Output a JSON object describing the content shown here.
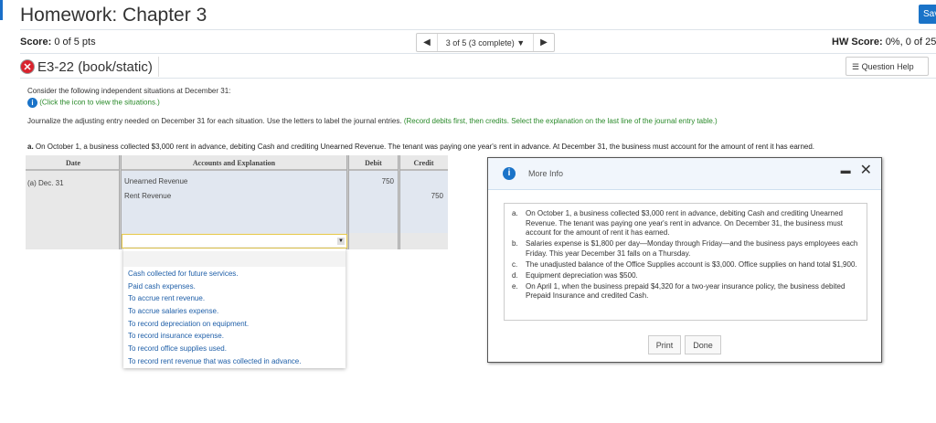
{
  "header": {
    "title": "Homework: Chapter 3",
    "save_label": "Sav"
  },
  "score": {
    "label": "Score:",
    "value": "0 of 5 pts"
  },
  "nav": {
    "prev": "◀",
    "position": "3 of 5 (3 complete) ▼",
    "next": "▶"
  },
  "hw_score": {
    "label": "HW Score:",
    "value": "0%, 0 of 25"
  },
  "question": {
    "id": "E3-22 (book/static)",
    "help_label": "Question Help"
  },
  "instructions": {
    "line1": "Consider the following independent situations at December 31:",
    "link": "(Click the icon to view the situations.)",
    "line3": "Journalize the adjusting entry needed on December 31 for each situation. Use the letters to label the journal entries.",
    "line3_hint": "(Record debits first, then credits. Select the explanation on the last line of the journal entry table.)"
  },
  "situation_a": {
    "letter": "a.",
    "text": "On October 1, a business collected $3,000 rent in advance, debiting Cash and crediting Unearned Revenue. The tenant was paying one year's rent in advance. At December 31, the business must account for the amount of rent it has earned."
  },
  "table": {
    "headers": [
      "Date",
      "Accounts and Explanation",
      "Debit",
      "Credit"
    ],
    "date": "(a) Dec. 31",
    "rows": [
      {
        "account": "Unearned Revenue",
        "debit": "750",
        "credit": ""
      },
      {
        "account": "Rent Revenue",
        "debit": "",
        "credit": "750"
      }
    ]
  },
  "dropdown": {
    "options": [
      "Cash collected for future services.",
      "Paid cash expenses.",
      "To accrue rent revenue.",
      "To accrue salaries expense.",
      "To record depreciation on equipment.",
      "To record insurance expense.",
      "To record office supplies used.",
      "To record rent revenue that was collected in advance."
    ]
  },
  "modal": {
    "title": "More Info",
    "minimize": "▬",
    "close": "✕",
    "items": [
      {
        "l": "a.",
        "t": "On October 1, a business collected $3,000 rent in advance, debiting Cash and crediting Unearned Revenue. The tenant was paying one year's rent in advance. On December 31, the business must account for the amount of rent it has earned."
      },
      {
        "l": "b.",
        "t": "Salaries expense is $1,800 per day—Monday through Friday—and the business pays employees each Friday. This year December 31 falls on a Thursday."
      },
      {
        "l": "c.",
        "t": "The unadjusted balance of the Office Supplies account is $3,000. Office supplies on hand total $1,900."
      },
      {
        "l": "d.",
        "t": "Equipment depreciation was $500."
      },
      {
        "l": "e.",
        "t": "On April 1, when the business prepaid $4,320 for a two-year insurance policy, the business debited Prepaid Insurance and credited Cash."
      }
    ],
    "print_label": "Print",
    "done_label": "Done"
  }
}
